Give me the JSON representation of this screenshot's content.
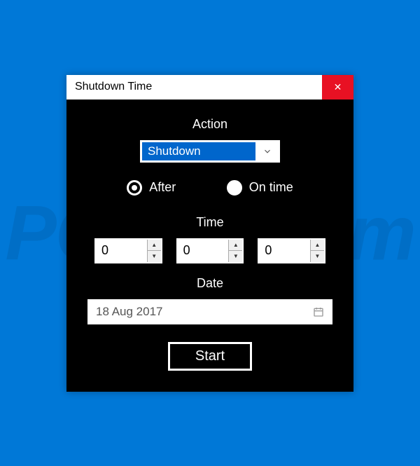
{
  "window": {
    "title": "Shutdown Time"
  },
  "labels": {
    "action": "Action",
    "time": "Time",
    "date": "Date"
  },
  "action": {
    "selected": "Shutdown"
  },
  "mode": {
    "after": "After",
    "on_time": "On time",
    "selected": "after"
  },
  "time": {
    "h": "0",
    "m": "0",
    "s": "0"
  },
  "date": {
    "value": "18 Aug 2017"
  },
  "buttons": {
    "start": "Start"
  },
  "watermark": "PCrisk.com"
}
